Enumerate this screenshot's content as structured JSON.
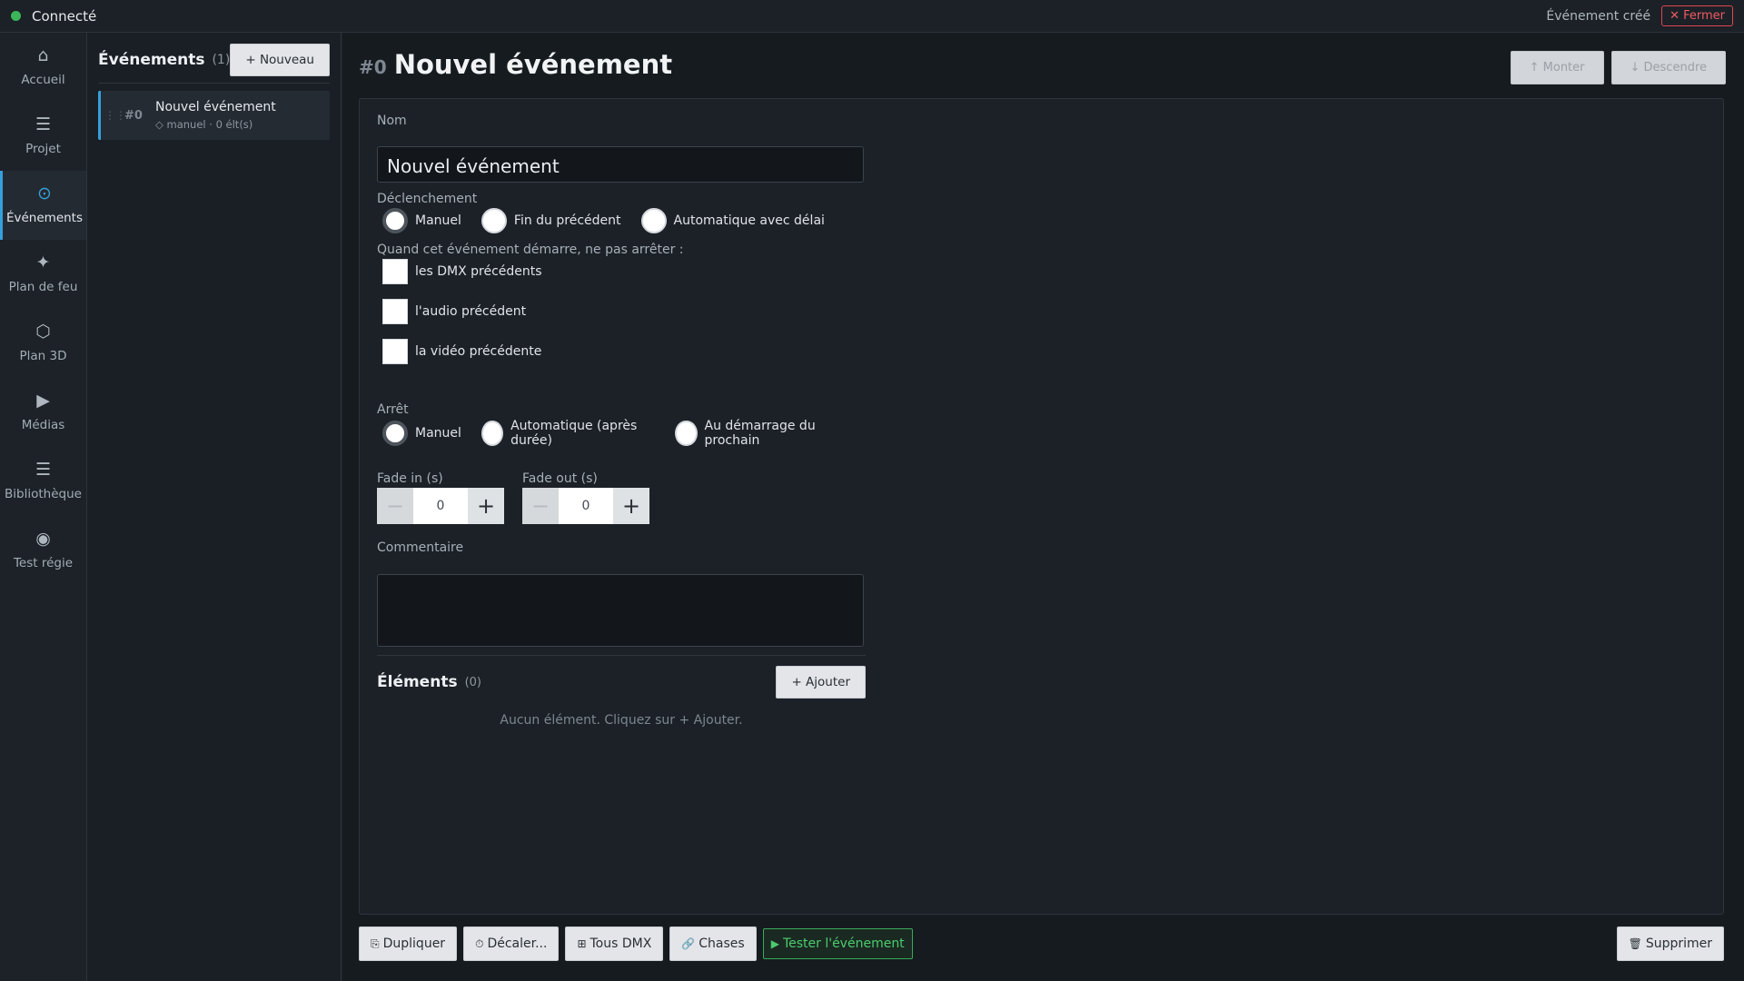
{
  "status": {
    "label": "Connecté",
    "color": "#3bb65a"
  },
  "notification": {
    "text": "Événement créé",
    "close_label": "✕ Fermer"
  },
  "nav": {
    "items": [
      {
        "icon": "⌂",
        "icon_name": "home-icon",
        "label": "Accueil"
      },
      {
        "icon": "☰",
        "icon_name": "project-icon",
        "label": "Projet"
      },
      {
        "icon": "⊙",
        "icon_name": "events-icon",
        "label": "Événements",
        "active": true
      },
      {
        "icon": "✦",
        "icon_name": "lighting-plan-icon",
        "label": "Plan de feu"
      },
      {
        "icon": "⬡",
        "icon_name": "3d-plan-icon",
        "label": "Plan 3D"
      },
      {
        "icon": "▶",
        "icon_name": "media-icon",
        "label": "Médias"
      },
      {
        "icon": "☰",
        "icon_name": "library-icon",
        "label": "Bibliothèque"
      },
      {
        "icon": "◉",
        "icon_name": "stage-test-icon",
        "label": "Test régie"
      }
    ]
  },
  "event_list": {
    "title": "Événements",
    "count": "(1)",
    "new_label": "+ Nouveau",
    "items": [
      {
        "grip": "⋮⋮",
        "number": "#0",
        "name": "Nouvel événement",
        "meta": "◇ manuel · 0 élt(s)"
      }
    ]
  },
  "editor": {
    "number": "#0",
    "title": "Nouvel événement",
    "move_up_label": "↑ Monter",
    "move_down_label": "↓ Descendre",
    "name_label": "Nom",
    "name_value": "Nouvel événement",
    "trigger_label": "Déclenchement",
    "trigger_options": [
      {
        "label": "Manuel",
        "selected": true
      },
      {
        "label": "Fin du précédent",
        "selected": false
      },
      {
        "label": "Automatique avec délai",
        "selected": false
      }
    ],
    "no_stop_label": "Quand cet événement démarre, ne pas arrêter :",
    "no_stop_options": [
      {
        "label": "les DMX précédents",
        "checked": false
      },
      {
        "label": "l'audio précédent",
        "checked": false
      },
      {
        "label": "la vidéo précédente",
        "checked": false
      }
    ],
    "stop_label": "Arrêt",
    "stop_options": [
      {
        "label": "Manuel",
        "selected": true
      },
      {
        "label": "Automatique (après durée)",
        "selected": false
      },
      {
        "label": "Au démarrage du prochain",
        "selected": false
      }
    ],
    "fade_in_label": "Fade in (s)",
    "fade_in_value": "0",
    "fade_out_label": "Fade out (s)",
    "fade_out_value": "0",
    "comment_label": "Commentaire",
    "comment_value": "",
    "elements_title": "Éléments",
    "elements_count": "(0)",
    "add_label": "+ Ajouter",
    "empty_text": "Aucun élément. Cliquez sur + Ajouter."
  },
  "footer": {
    "duplicate_icon": "⎘",
    "duplicate_label": "Dupliquer",
    "shift_icon": "⏱",
    "shift_label": "Décaler...",
    "dmx_icon": "⊞",
    "dmx_label": "Tous DMX",
    "chases_icon": "🔗",
    "chases_label": "Chases",
    "test_icon": "▶",
    "test_label": "Tester l'événement",
    "delete_icon": "🗑",
    "delete_label": "Supprimer"
  }
}
